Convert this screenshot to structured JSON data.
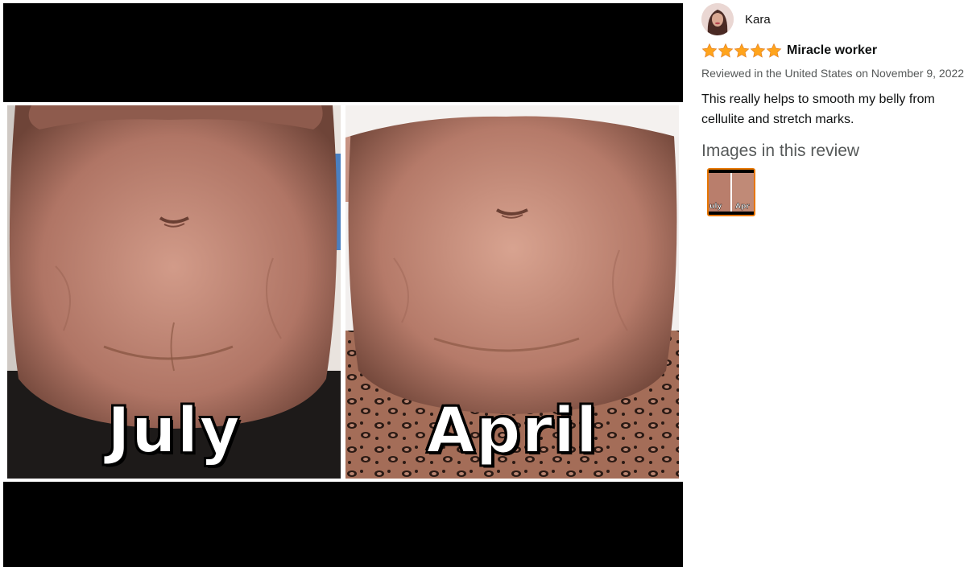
{
  "viewer": {
    "left_label": "July",
    "right_label": "April"
  },
  "review": {
    "reviewer_name": "Kara",
    "rating": 5,
    "title": "Miracle worker",
    "meta": "Reviewed in the United States on November 9, 2022",
    "body": "This really helps to smooth my belly from cellulite and stretch marks.",
    "images_heading": "Images in this review",
    "thumbnail_labels": [
      "uly",
      "Apr"
    ]
  },
  "colors": {
    "star": "#ffa41c",
    "thumb_border": "#e77600",
    "skin": "#b97e6c"
  }
}
